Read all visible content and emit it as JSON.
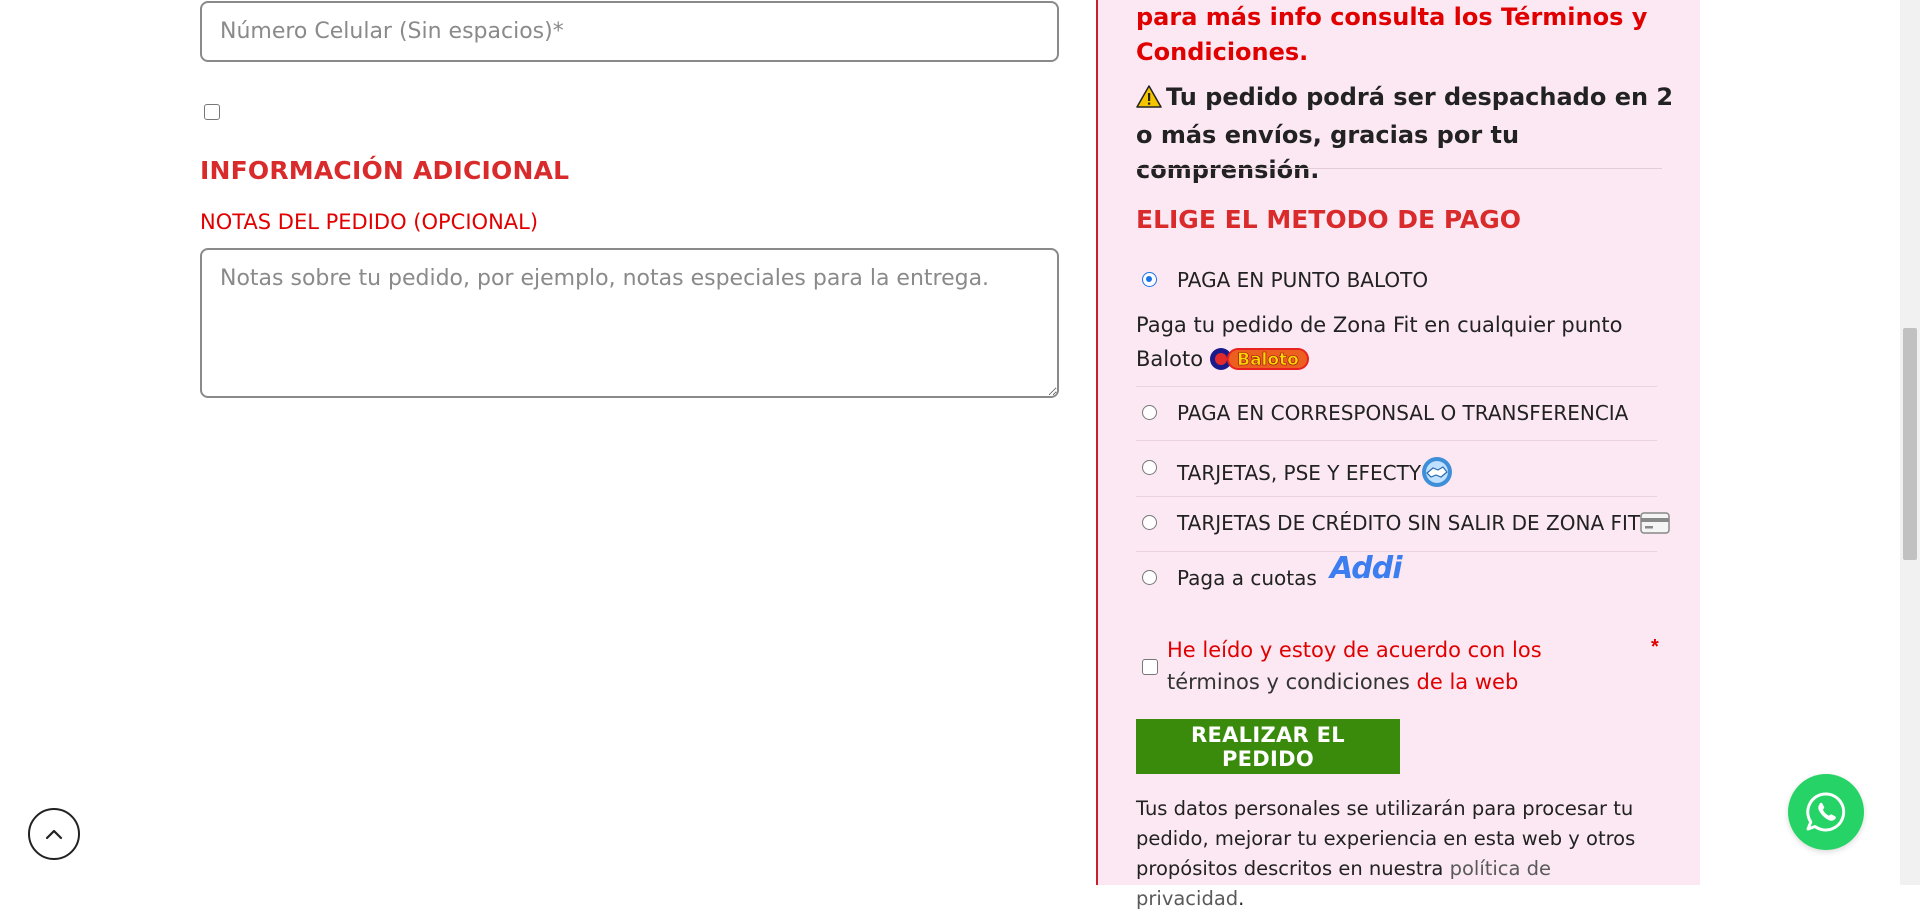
{
  "billing": {
    "phone_placeholder": "Número Celular (Sin espacios)*"
  },
  "additional": {
    "heading": "INFORMACIÓN ADICIONAL",
    "notes_label": "NOTAS DEL PEDIDO (OPCIONAL)",
    "notes_placeholder": "Notas sobre tu pedido, por ejemplo, notas especiales para la entrega."
  },
  "summary": {
    "terms_note": "para más info consulta los Términos y Condiciones.",
    "ship_note": "Tu pedido podrá ser despachado en 2 o más envíos, gracias por tu comprensión."
  },
  "payment": {
    "heading": "ELIGE EL METODO DE PAGO",
    "options": [
      {
        "label": "PAGA EN PUNTO BALOTO",
        "selected": true
      },
      {
        "label": "PAGA EN CORRESPONSAL O TRANSFERENCIA",
        "selected": false
      },
      {
        "label": "TARJETAS, PSE Y EFECTY",
        "selected": false
      },
      {
        "label": "TARJETAS DE CRÉDITO SIN SALIR DE ZONA FIT",
        "selected": false
      },
      {
        "label": "Paga a cuotas",
        "selected": false
      }
    ],
    "baloto_desc": "Paga tu pedido de Zona Fit en cualquier punto Baloto",
    "baloto_logo_text": "Baloto",
    "addi_logo_text": "Addi"
  },
  "terms": {
    "part1": "He leído y estoy de acuerdo con los",
    "link": "términos y condiciones",
    "part2": "de la web",
    "required_mark": "*"
  },
  "order_button": "REALIZAR EL PEDIDO",
  "privacy": {
    "text": "Tus datos personales se utilizarán para procesar tu pedido, mejorar tu experiencia en esta web y otros propósitos descritos en nuestra",
    "link": "política de privacidad",
    "end": "."
  },
  "colors": {
    "accent_red": "#d92b2b",
    "panel_bg": "#fbe8f3",
    "button_green": "#3a8b0c",
    "whatsapp_green": "#25d366"
  },
  "icons": [
    "warning-icon",
    "baloto-logo",
    "handshake-icon",
    "credit-card-icon",
    "addi-logo",
    "chevron-up-icon",
    "whatsapp-icon"
  ]
}
